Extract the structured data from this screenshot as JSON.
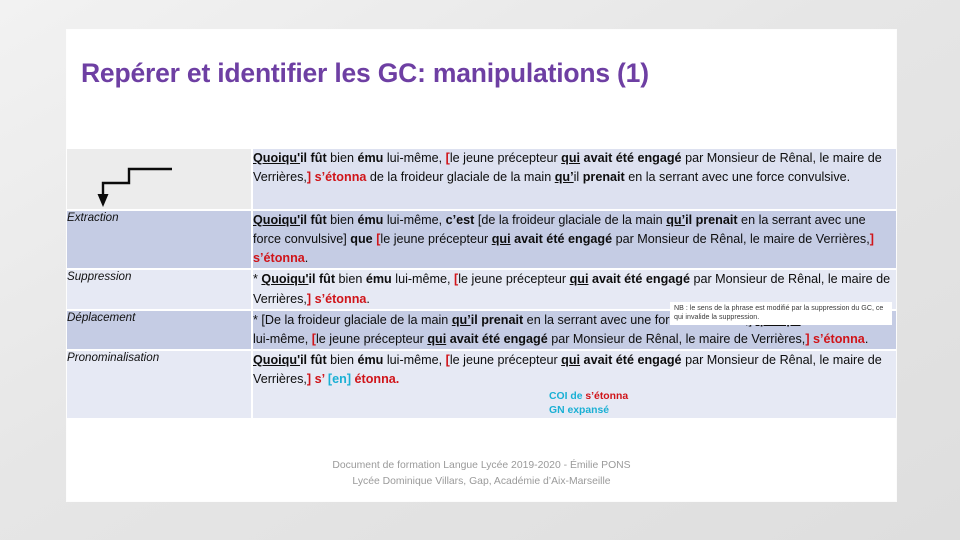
{
  "slide": {
    "title": "Repérer et identifier les GC: manipulations (1)",
    "title_color": "#6E3FA3",
    "accent_red": "#d01419",
    "accent_cyan": "#1ab0d4",
    "band_a_color": "#c5cce4",
    "band_b_color": "#e6e9f4"
  },
  "table": {
    "rows": [
      {
        "label": "",
        "icon": "elbow-arrow-down-icon",
        "band": "head",
        "text_plain": "Quoiqu'il fût bien ému lui-même, [le jeune précepteur qui avait été engagé par Monsieur de Rênal, le maire de Verrières,] s’étonna de la froideur glaciale de la main qu’il prenait en la serrant avec une force convulsive.",
        "parts": [
          {
            "t": "Quoiqu'",
            "s": "bu"
          },
          {
            "t": "il fût ",
            "s": "b"
          },
          {
            "t": "bien ",
            "s": "n"
          },
          {
            "t": "ému ",
            "s": "b"
          },
          {
            "t": "lui-même, ",
            "s": "n"
          },
          {
            "t": "[",
            "s": "red-b"
          },
          {
            "t": "le jeune précepteur ",
            "s": "n"
          },
          {
            "t": "qui",
            "s": "bu"
          },
          {
            "t": " avait été engagé ",
            "s": "b"
          },
          {
            "t": "par Monsieur de Rênal, le maire de Verrières,",
            "s": "n"
          },
          {
            "t": "]",
            "s": "red-b"
          },
          {
            "t": " s’étonna",
            "s": "red-b"
          },
          {
            "t": " de la froideur glaciale de la main ",
            "s": "n"
          },
          {
            "t": "qu’",
            "s": "bu"
          },
          {
            "t": "il ",
            "s": "n"
          },
          {
            "t": "prenait",
            "s": "b"
          },
          {
            "t": " en la serrant avec une force convulsive.",
            "s": "n"
          }
        ]
      },
      {
        "label": "Extraction",
        "band": "a",
        "text_plain": "Quoiqu'il fût bien ému lui-même, c’est [de la froideur glaciale de la main qu’il prenait en la serrant avec une force convulsive] que [le jeune précepteur qui avait été engagé par Monsieur de Rênal, le maire de Verrières,] s’étonna.",
        "parts": [
          {
            "t": "Quoiqu'",
            "s": "bu"
          },
          {
            "t": "il fût ",
            "s": "b"
          },
          {
            "t": "bien ",
            "s": "n"
          },
          {
            "t": "ému ",
            "s": "b"
          },
          {
            "t": "lui-même, ",
            "s": "n"
          },
          {
            "t": "c’est ",
            "s": "b"
          },
          {
            "t": "[de la froideur glaciale de la main ",
            "s": "n"
          },
          {
            "t": "qu’",
            "s": "bu"
          },
          {
            "t": "il prenait",
            "s": "b"
          },
          {
            "t": " en la serrant avec une force convulsive] ",
            "s": "n"
          },
          {
            "t": "que ",
            "s": "b"
          },
          {
            "t": "[",
            "s": "red-b"
          },
          {
            "t": "le jeune précepteur ",
            "s": "n"
          },
          {
            "t": "qui",
            "s": "bu"
          },
          {
            "t": " avait été engagé ",
            "s": "b"
          },
          {
            "t": "par Monsieur de Rênal, le maire de Verrières,",
            "s": "n"
          },
          {
            "t": "]",
            "s": "red-b"
          },
          {
            "t": " s’étonna",
            "s": "red-b"
          },
          {
            "t": ".",
            "s": "n"
          }
        ]
      },
      {
        "label": "Suppression",
        "band": "b",
        "text_plain": "* Quoiqu'il fût bien ému lui-même, [le jeune précepteur qui avait été engagé par Monsieur de Rênal, le maire de Verrières,] s’étonna.",
        "note": "NB : le sens de la phrase est modifié par la suppression du GC, ce qui invalide la suppression.",
        "parts": [
          {
            "t": "* ",
            "s": "n"
          },
          {
            "t": "Quoiqu'",
            "s": "bu"
          },
          {
            "t": "il fût ",
            "s": "b"
          },
          {
            "t": "bien ",
            "s": "n"
          },
          {
            "t": "ému ",
            "s": "b"
          },
          {
            "t": "lui-même, ",
            "s": "n"
          },
          {
            "t": "[",
            "s": "red-b"
          },
          {
            "t": "le jeune précepteur ",
            "s": "n"
          },
          {
            "t": "qui",
            "s": "bu"
          },
          {
            "t": " avait été engagé ",
            "s": "b"
          },
          {
            "t": "par Monsieur de Rênal, le maire de Verrières,",
            "s": "n"
          },
          {
            "t": "]",
            "s": "red-b"
          },
          {
            "t": " s’étonna",
            "s": "red-b"
          },
          {
            "t": ".",
            "s": "n"
          }
        ]
      },
      {
        "label": "Déplacement",
        "band": "a",
        "text_plain": "* [De la froideur glaciale de la main qu’il prenait en la serrant avec une force convulsive,] quoiqu'il fût bien ému lui-même, [le jeune précepteur qui avait été engagé par Monsieur de Rênal, le maire de Verrières,] s’étonna.",
        "parts": [
          {
            "t": "* [De la froideur glaciale de la main ",
            "s": "n"
          },
          {
            "t": "qu’",
            "s": "bu"
          },
          {
            "t": "il prenait",
            "s": "b"
          },
          {
            "t": " en la serrant avec une force convulsive,] ",
            "s": "n"
          },
          {
            "t": "quoiqu'",
            "s": "bu"
          },
          {
            "t": "il fût ",
            "s": "b"
          },
          {
            "t": "bien ",
            "s": "n"
          },
          {
            "t": "ému ",
            "s": "b"
          },
          {
            "t": "lui-même, ",
            "s": "n"
          },
          {
            "t": "[",
            "s": "red-b"
          },
          {
            "t": "le jeune précepteur ",
            "s": "n"
          },
          {
            "t": "qui",
            "s": "bu"
          },
          {
            "t": " avait été engagé ",
            "s": "b"
          },
          {
            "t": "par Monsieur de Rênal, le maire de Verrières,",
            "s": "n"
          },
          {
            "t": "]",
            "s": "red-b"
          },
          {
            "t": " s’étonna",
            "s": "red-b"
          },
          {
            "t": ".",
            "s": "n"
          }
        ]
      },
      {
        "label": "Pronominalisation",
        "band": "b",
        "text_plain": "Quoiqu'il fût bien ému lui-même, [le jeune précepteur qui avait été engagé par Monsieur de Rênal, le maire de Verrières,] s’ [en] étonna.",
        "annotation_line1_a": "COI de ",
        "annotation_line1_b": "s’étonna",
        "annotation_line2": "GN expansé",
        "parts": [
          {
            "t": "Quoiqu'",
            "s": "bu"
          },
          {
            "t": "il fût ",
            "s": "b"
          },
          {
            "t": "bien ",
            "s": "n"
          },
          {
            "t": "ému ",
            "s": "b"
          },
          {
            "t": "lui-même, ",
            "s": "n"
          },
          {
            "t": "[",
            "s": "red-b"
          },
          {
            "t": "le jeune précepteur ",
            "s": "n"
          },
          {
            "t": "qui",
            "s": "bu"
          },
          {
            "t": " avait été engagé ",
            "s": "b"
          },
          {
            "t": "par Monsieur de Rênal, le maire de Verrières,",
            "s": "n"
          },
          {
            "t": "]",
            "s": "red-b"
          },
          {
            "t": " s’ ",
            "s": "red-b"
          },
          {
            "t": "[en]",
            "s": "cyan-b"
          },
          {
            "t": " étonna.",
            "s": "red-b"
          }
        ]
      }
    ]
  },
  "footer": {
    "line1": "Document de formation Langue Lycée  2019-2020 - Émilie PONS",
    "line2": "Lycée Dominique Villars, Gap, Académie d’Aix-Marseille"
  }
}
